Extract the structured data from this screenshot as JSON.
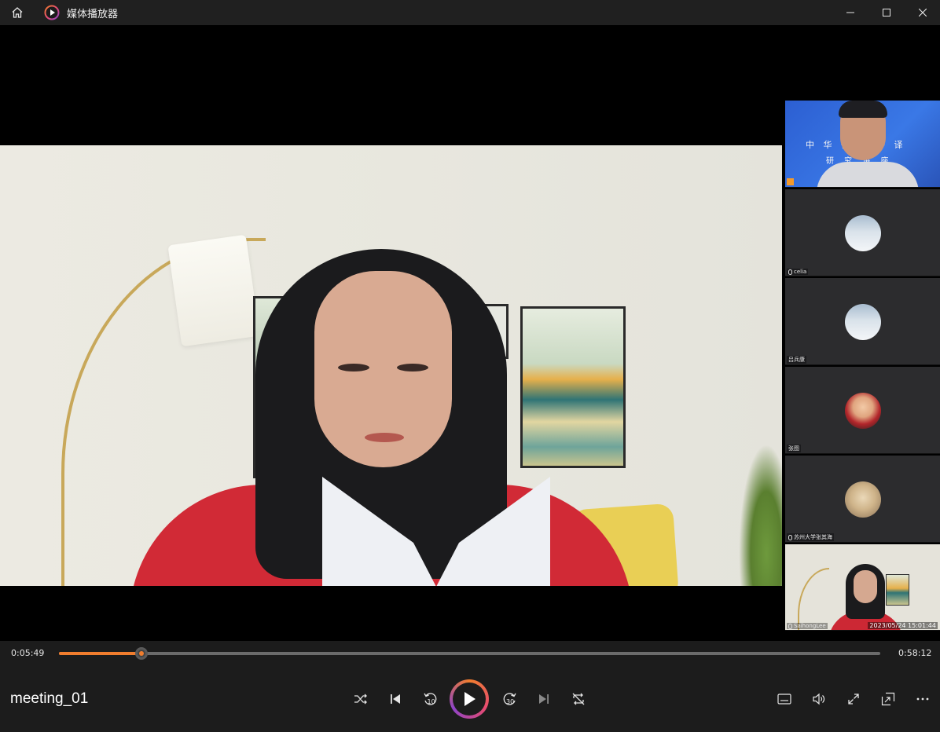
{
  "app": {
    "title": "媒体播放器",
    "icons": {
      "home": "home-icon",
      "app": "media-player-icon",
      "minimize": "minimize-icon",
      "maximize": "maximize-icon",
      "close": "close-icon"
    }
  },
  "video": {
    "participants": [
      {
        "name": "",
        "role": "host",
        "banner_line1": "中 华 徒 化 外 译",
        "banner_line2": "研 究  讲 座"
      },
      {
        "name": "celia",
        "avatar": "snow-landscape"
      },
      {
        "name": "吕兵康",
        "avatar": "snow-landscape"
      },
      {
        "name": "张图",
        "avatar": "child-photo"
      },
      {
        "name": "苏州大学张其海",
        "avatar": "cat-photo"
      },
      {
        "name": "SaihongLee",
        "self": true
      }
    ],
    "timestamp": "2023/05/24 15:01:44"
  },
  "playback": {
    "current_time": "0:05:49",
    "total_time": "0:58:12",
    "progress": 0.1,
    "accent_color": "#f07d2e",
    "media_title": "meeting_01",
    "skip_back_seconds": "10",
    "skip_forward_seconds": "30"
  },
  "controls": {
    "left": [
      "shuffle-icon",
      "previous-icon",
      "skip-back-10-icon",
      "play-icon",
      "skip-forward-30-icon",
      "next-icon",
      "repeat-off-icon"
    ],
    "right": [
      "subtitles-icon",
      "volume-icon",
      "fullscreen-icon",
      "mini-player-icon",
      "more-icon"
    ]
  }
}
